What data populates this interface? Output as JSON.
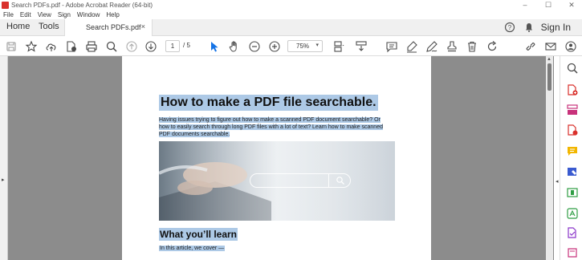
{
  "window": {
    "title": "Search PDFs.pdf - Adobe Acrobat Reader (64-bit)",
    "controls": [
      "–",
      "☐",
      "✕"
    ]
  },
  "menu": [
    "File",
    "Edit",
    "View",
    "Sign",
    "Window",
    "Help"
  ],
  "tabs": {
    "home": "Home",
    "tools": "Tools",
    "document": "Search PDFs.pdf",
    "close": "×",
    "sign_in": "Sign In"
  },
  "toolbar": {
    "current_page": "1",
    "total_pages": "/ 5",
    "zoom": "75%",
    "zoom_caret": "▾"
  },
  "document": {
    "title": "How to make a PDF file searchable.",
    "intro": "Having issues trying to figure out how to make a scanned PDF document searchable? Or how to easily search through long PDF files with a lot of text? Learn how to make scanned PDF documents searchable.",
    "heading2": "What you’ll learn",
    "subtext": "In this article, we cover —"
  },
  "colors": {
    "selection_highlight": "#adc9e6",
    "accent_blue": "#1473e6",
    "icon_gray": "#4b4b4b"
  },
  "icons": {
    "toolbar": [
      "save-icon",
      "bookmark-star-icon",
      "upload-cloud-icon",
      "file-info-icon",
      "print-icon",
      "find-icon",
      "prev-page-icon",
      "next-page-icon",
      "select-pointer-icon",
      "hand-icon",
      "zoom-out-icon",
      "zoom-in-icon",
      "page-fit-icon",
      "scroll-mode-icon",
      "comment-icon",
      "highlight-pen-icon",
      "draw-icon",
      "stamp-icon",
      "delete-icon",
      "rotate-icon",
      "link-icon",
      "email-icon",
      "share-user-icon"
    ],
    "sidebar": [
      "search-icon",
      "create-pdf-icon",
      "organize-icon",
      "export-pdf-icon",
      "comment-icon",
      "fill-sign-icon",
      "edit-pdf-icon",
      "scan-ocr-icon",
      "more-tools-icon"
    ]
  }
}
